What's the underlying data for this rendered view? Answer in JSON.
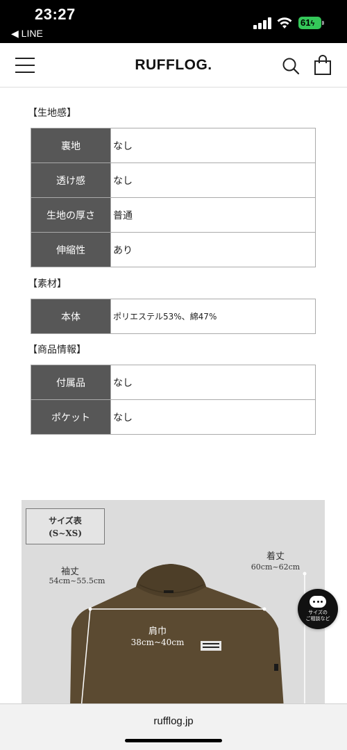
{
  "status_bar": {
    "time": "23:27",
    "back_app": "◀ LINE",
    "battery": "61"
  },
  "header": {
    "logo": "RUFFLOG."
  },
  "sections": {
    "fabric": {
      "title": "【生地感】",
      "rows": [
        {
          "key": "裏地",
          "value": "なし"
        },
        {
          "key": "透け感",
          "value": "なし"
        },
        {
          "key": "生地の厚さ",
          "value": "普通"
        },
        {
          "key": "伸縮性",
          "value": "あり"
        }
      ]
    },
    "material": {
      "title": "【素材】",
      "rows": [
        {
          "key": "本体",
          "value": "ポリエステル53%、綿47%"
        }
      ]
    },
    "product": {
      "title": "【商品情報】",
      "rows": [
        {
          "key": "付属品",
          "value": "なし"
        },
        {
          "key": "ポケット",
          "value": "なし"
        }
      ]
    }
  },
  "size_chart": {
    "title": "サイズ表",
    "size_range": "(S~XS)",
    "sleeve_label": "袖丈",
    "sleeve_value": "54cm~55.5cm",
    "length_label": "着丈",
    "length_value": "60cm~62cm",
    "shoulder_label": "肩巾",
    "shoulder_value": "38cm~40cm",
    "shirt_color": "#5b4a31",
    "background_color": "#dcdcdc"
  },
  "chat": {
    "label_line1": "サイズの",
    "label_line2": "ご相談など"
  },
  "browser": {
    "url": "rufflog.jp"
  },
  "colors": {
    "table_key_bg": "#575757",
    "battery_green": "#34c759"
  }
}
